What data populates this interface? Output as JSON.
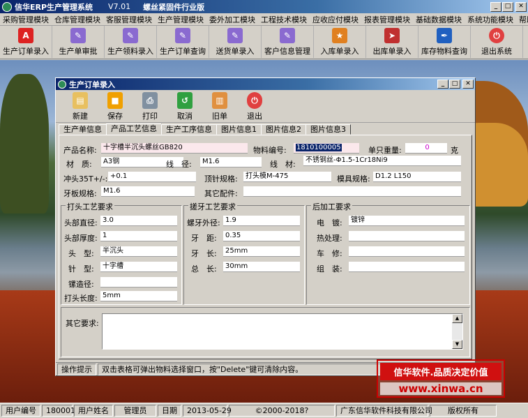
{
  "window": {
    "app_title": "信华ERP生产管理系统",
    "version": "V7.01",
    "edition": "螺丝紧固件行业版",
    "controls": {
      "minimize": "_",
      "maximize": "□",
      "close": "✕"
    }
  },
  "menu": [
    "采购管理模块",
    "仓库管理模块",
    "客服管理模块",
    "生产管理模块",
    "委外加工模块",
    "工程技术模块",
    "应收应付模块",
    "报表管理模块",
    "基础数据模块",
    "系统功能模块",
    "帮助"
  ],
  "toolbar": [
    {
      "label": "生产订单录入",
      "icon": "pdf-icon",
      "color": "#d22"
    },
    {
      "label": "生产单审批",
      "icon": "document-icon",
      "color": "#8a6ad0"
    },
    {
      "label": "生产领料录入",
      "icon": "document-icon",
      "color": "#8a6ad0"
    },
    {
      "label": "生产订单查询",
      "icon": "document-icon",
      "color": "#8a6ad0"
    },
    {
      "label": "送货单录入",
      "icon": "document-icon",
      "color": "#8a6ad0"
    },
    {
      "label": "客户信息管理",
      "icon": "document-icon",
      "color": "#8a6ad0"
    },
    {
      "label": "入库单录入",
      "icon": "star-icon",
      "color": "#e08020"
    },
    {
      "label": "出库单录入",
      "icon": "arrow-icon",
      "color": "#c03030"
    },
    {
      "label": "库存物料查询",
      "icon": "pen-icon",
      "color": "#2060c0"
    },
    {
      "label": "退出系统",
      "icon": "exit-icon",
      "color": "#e04040"
    }
  ],
  "child_window": {
    "title": "生产订单录入",
    "tools": [
      {
        "label": "新建",
        "icon": "new-icon",
        "color": "#e8c060"
      },
      {
        "label": "保存",
        "icon": "save-icon",
        "color": "#f0a000"
      },
      {
        "label": "打印",
        "icon": "printer-icon",
        "color": "#8090a0"
      },
      {
        "label": "取消",
        "icon": "undo-icon",
        "color": "#30a040"
      },
      {
        "label": "旧单",
        "icon": "book-icon",
        "color": "#e09040"
      },
      {
        "label": "退出",
        "icon": "exit-icon",
        "color": "#e04040"
      }
    ],
    "tabs": [
      "生产单信息",
      "产品工艺信息",
      "生产工序信息",
      "图片信息1",
      "图片信息2",
      "图片信息3"
    ],
    "active_tab": 1,
    "product": {
      "name_label": "产品名称:",
      "name": "十字槽半沉头螺丝GB820",
      "code_label": "物料编号:",
      "code": "1810100005",
      "unit_weight_label": "单只重量:",
      "unit_weight": "0",
      "unit_weight_unit": "克",
      "material_label": "材　质:",
      "material": "A3钢",
      "diameter_label": "线　径:",
      "diameter": "M1.6",
      "wire_label": "线　材:",
      "wire": "不锈钢丝-Φ1.5-1Cr18Ni9",
      "punch_label": "冲头35T+/-:",
      "punch": "+0.1",
      "top_spec_label": "顶针规格:",
      "top_spec": "打头模M-475",
      "die_spec_label": "模具规格:",
      "die_spec": "D1.2 L150",
      "thread_spec_label": "牙板规格:",
      "thread_spec": "M1.6",
      "other_parts_label": "其它配件:",
      "other_parts": ""
    },
    "head": {
      "title": "打头工艺要求",
      "fields": [
        {
          "label": "头部直径:",
          "value": "3.0"
        },
        {
          "label": "头部厚度:",
          "value": "1"
        },
        {
          "label": "头　型:",
          "value": "半沉头"
        },
        {
          "label": "针　型:",
          "value": "十字槽"
        },
        {
          "label": "镙造径:",
          "value": ""
        },
        {
          "label": "打头长度:",
          "value": "5mm"
        }
      ]
    },
    "thread": {
      "title": "搓牙工艺要求",
      "fields": [
        {
          "label": "螺牙外径:",
          "value": "1.9"
        },
        {
          "label": "牙　距:",
          "value": "0.35"
        },
        {
          "label": "牙　长:",
          "value": "25mm"
        },
        {
          "label": "总　长:",
          "value": "30mm"
        }
      ]
    },
    "post": {
      "title": "后加工要求",
      "fields": [
        {
          "label": "电　镀:",
          "value": "镀锌"
        },
        {
          "label": "热处理:",
          "value": ""
        },
        {
          "label": "车　修:",
          "value": ""
        },
        {
          "label": "组　装:",
          "value": ""
        }
      ]
    },
    "other_req_label": "其它要求:",
    "other_req": "",
    "hint_label": "操作提示",
    "hint": "双击表格可弹出物料选择窗口，按\"Delete\"键可清除内容。"
  },
  "watermark": {
    "line1": "信华软件.品质决定价值",
    "line2": "www.xinwa.cn"
  },
  "statusbar": {
    "user_id_label": "用户编号",
    "user_id": "180001",
    "user_name_label": "用户姓名",
    "user_name": "管理员",
    "date_label": "日期",
    "date": "2013-05-29",
    "copyright": "©2000-2018?",
    "company": "广东信华软件科技有限公司",
    "rights": "版权所有"
  }
}
